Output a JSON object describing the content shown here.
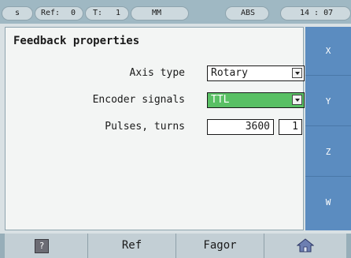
{
  "status_bar": {
    "mode": "s",
    "ref_label": "Ref:",
    "ref_value": "0",
    "tool_label": "T:",
    "tool_value": "1",
    "units": "MM",
    "coord": "ABS",
    "time": "14 : 07"
  },
  "panel": {
    "title": "Feedback properties",
    "axis_type": {
      "label": "Axis type",
      "value": "Rotary"
    },
    "encoder": {
      "label": "Encoder signals",
      "value": "TTL"
    },
    "pulses": {
      "label": "Pulses, turns",
      "value": "3600",
      "turns": "1"
    }
  },
  "axes": [
    "X",
    "Y",
    "Z",
    "W"
  ],
  "softkeys": {
    "help": "?",
    "ref": "Ref",
    "fagor": "Fagor",
    "home_icon": "home-icon"
  },
  "colors": {
    "status_bar": "#9fb8c3",
    "axis_active": "#5b8cc0",
    "select_highlight": "#59c064",
    "panel_bg": "#f3f5f4"
  }
}
